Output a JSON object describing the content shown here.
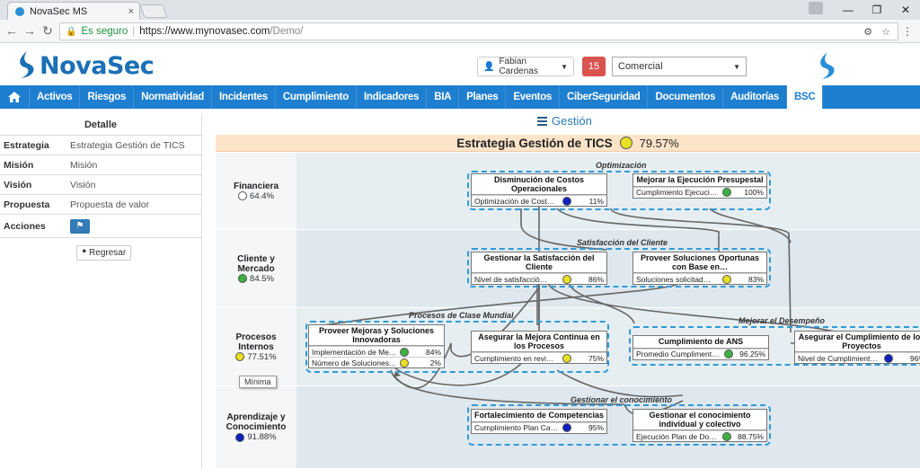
{
  "browser": {
    "tab_title": "NovaSec MS",
    "tab_close": "×",
    "secure_label": "Es seguro",
    "url_host": "https://www.mynovasec.com",
    "url_path": "/Demo/",
    "window_buttons": [
      "—",
      "❐",
      "✕"
    ]
  },
  "header": {
    "logo_text": "NovaSec",
    "user_name": "Fabian Cardenas",
    "notifications": "15",
    "org_selected": "Comercial"
  },
  "nav": {
    "items": [
      "Activos",
      "Riesgos",
      "Normatividad",
      "Incidentes",
      "Cumplimiento",
      "Indicadores",
      "BIA",
      "Planes",
      "Eventos",
      "CiberSeguridad",
      "Documentos",
      "Auditorías",
      "BSC"
    ],
    "active": "BSC"
  },
  "detail": {
    "title": "Detalle",
    "rows": [
      {
        "key": "Estrategia",
        "value": "Estrategia Gestión de TICS"
      },
      {
        "key": "Misión",
        "value": "Misión"
      },
      {
        "key": "Visión",
        "value": "Visión"
      },
      {
        "key": "Propuesta",
        "value": "Propuesta de valor"
      },
      {
        "key": "Acciones",
        "value": ""
      }
    ],
    "back_label": "Regresar"
  },
  "map": {
    "section_title": "Gestión",
    "strategy_title": "Estrategia Gestión de TICS",
    "strategy_pct": "79.57%",
    "strategy_color": "#e8e020",
    "tooltip": "Mínima",
    "perspectives": [
      {
        "name": "Financiera",
        "pct": "64.4%",
        "color": "#ffffff"
      },
      {
        "name": "Cliente y Mercado",
        "pct": "84.5%",
        "color": "#3cb043"
      },
      {
        "name": "Procesos Internos",
        "pct": "77.51%",
        "color": "#e8e020"
      },
      {
        "name": "Aprendizaje y Conocimiento",
        "pct": "91.88%",
        "color": "#1020c0"
      }
    ],
    "groups": {
      "optimizacion": "Optimización",
      "satisfaccion": "Satisfacción del Cliente",
      "procesos": "Procesos de Clase Mundial",
      "desempeno": "Mejorar el Desempeño",
      "conocimiento": "Gestionar el conocimiento"
    },
    "objectives": {
      "costos": {
        "title": "Disminución de Costos Operacionales",
        "kpis": [
          {
            "name": "Optimización de Cost…",
            "value": "11%",
            "color": "#1020c0"
          }
        ]
      },
      "presupuestal": {
        "title": "Mejorar la Ejecución Presupestal",
        "kpis": [
          {
            "name": "Cumplimiento Ejecuci…",
            "value": "100%",
            "color": "#3cb043"
          }
        ]
      },
      "satisfaccion": {
        "title": "Gestionar la Satisfacción del Cliente",
        "kpis": [
          {
            "name": "Nivel de satisfacció…",
            "value": "86%",
            "color": "#e8e020"
          }
        ]
      },
      "soluciones": {
        "title": "Proveer Soluciones Oportunas con Base en…",
        "kpis": [
          {
            "name": "Soluciones solicitad…",
            "value": "83%",
            "color": "#e8e020"
          }
        ]
      },
      "mejoras": {
        "title": "Proveer Mejoras y Soluciones Innovadoras",
        "kpis": [
          {
            "name": "Implementación de Me…",
            "value": "84%",
            "color": "#3cb043"
          },
          {
            "name": "Número de Soluciones…",
            "value": "2%",
            "color": "#e8e020"
          }
        ]
      },
      "continua": {
        "title": "Asegurar la Mejora Continua en los Procesos",
        "kpis": [
          {
            "name": "Cumplimiento en revi…",
            "value": "75%",
            "color": "#e8e020"
          }
        ]
      },
      "ans": {
        "title": "Cumplimiento de ANS",
        "kpis": [
          {
            "name": "Promedio Cumpliment…",
            "value": "96.25%",
            "color": "#3cb043"
          }
        ]
      },
      "proyectos": {
        "title": "Asegurar el Cumplimiento de los Proyectos",
        "kpis": [
          {
            "name": "Nivel de Cumplimient…",
            "value": "96%",
            "color": "#1020c0"
          }
        ]
      },
      "competencias": {
        "title": "Fortalecimiento de Competencias",
        "kpis": [
          {
            "name": "Cumplimiento Plan Ca…",
            "value": "95%",
            "color": "#1020c0"
          }
        ]
      },
      "gestion": {
        "title": "Gestionar el conocimiento individual y colectivo",
        "kpis": [
          {
            "name": "Ejecución Plan de Do…",
            "value": "88.75%",
            "color": "#3cb043"
          }
        ]
      }
    }
  }
}
